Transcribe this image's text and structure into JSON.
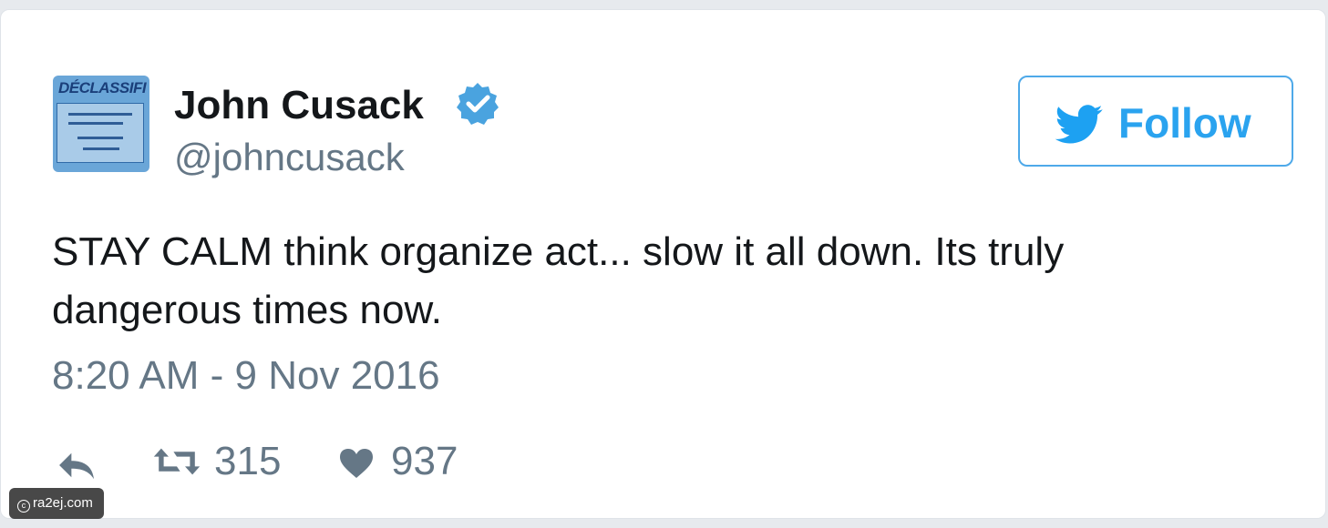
{
  "tweet": {
    "avatar_text": "DÉCLASSIFI",
    "display_name": "John Cusack",
    "handle": "@johncusack",
    "follow_label": "Follow",
    "text": "STAY CALM think organize act... slow it all down. Its truly dangerous times now.",
    "timestamp": "8:20 AM - 9 Nov 2016",
    "retweets": "315",
    "likes": "937"
  },
  "watermark": {
    "copyright_glyph": "c",
    "text": "ra2ej.com"
  },
  "icons": {
    "verified": "verified-badge-icon",
    "follow": "twitter-bird-icon",
    "reply": "reply-icon",
    "retweet": "retweet-icon",
    "like": "heart-icon"
  },
  "colors": {
    "accent": "#1da1f2",
    "verified": "#4aa3df",
    "text": "#14171a",
    "secondary_text": "#657786",
    "action_icon": "#657786"
  }
}
